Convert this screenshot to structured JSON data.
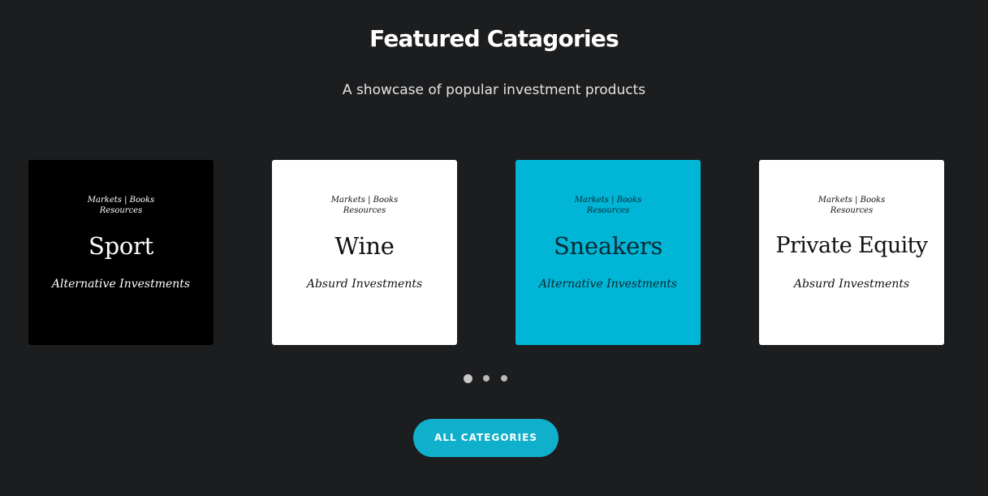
{
  "section": {
    "title": "Featured Catagories",
    "subtitle": "A showcase of popular investment products"
  },
  "cards": [
    {
      "meta_line1": "Markets | Books",
      "meta_line2": "Resources",
      "name": "Sport",
      "kind": "Alternative Investments",
      "background": "#000000",
      "text_color": "#ffffff"
    },
    {
      "meta_line1": "Markets | Books",
      "meta_line2": "Resources",
      "name": "Wine",
      "kind": "Absurd Investments",
      "background": "#ffffff",
      "text_color": "#111111"
    },
    {
      "meta_line1": "Markets | Books",
      "meta_line2": "Resources",
      "name": "Sneakers",
      "kind": "Alternative Investments",
      "background": "#00b5d6",
      "text_color": "#0a2a33"
    },
    {
      "meta_line1": "Markets | Books",
      "meta_line2": "Resources",
      "name": "Private Equity",
      "kind": "Absurd Investments",
      "background": "#ffffff",
      "text_color": "#111111"
    }
  ],
  "pagination": {
    "pages": 3,
    "active_index": 0
  },
  "cta": {
    "label": "ALL CATEGORIES",
    "color": "#10b0cc"
  }
}
